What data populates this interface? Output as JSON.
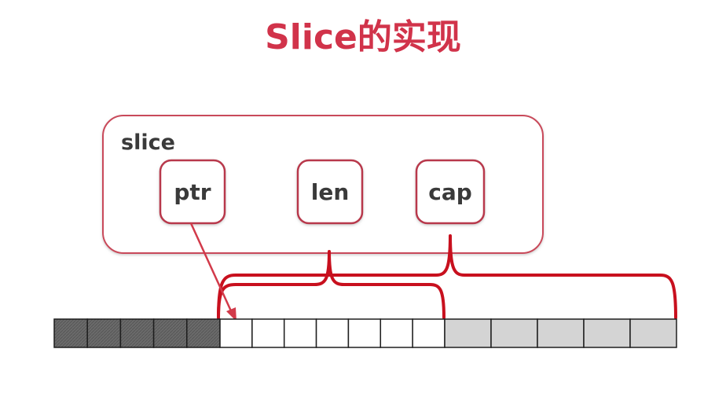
{
  "title": "Slice的实现",
  "slice": {
    "label": "slice",
    "fields": [
      {
        "id": "ptr",
        "label": "ptr"
      },
      {
        "id": "len",
        "label": "len"
      },
      {
        "id": "cap",
        "label": "cap"
      }
    ]
  },
  "colors": {
    "title": "#d1334a",
    "box_border": "#c94a5a",
    "brace": "#c8101e",
    "arrow": "#d23a4a",
    "cell_before": "#6a6a6a",
    "cell_len": "#ffffff",
    "cell_cap": "#d4d4d4"
  },
  "array": {
    "segments": [
      {
        "role": "before-ptr",
        "count": 5,
        "color_key": "cell_before"
      },
      {
        "role": "len-region",
        "count": 7,
        "color_key": "cell_len"
      },
      {
        "role": "cap-extra-region",
        "count": 5,
        "color_key": "cell_cap"
      }
    ]
  }
}
